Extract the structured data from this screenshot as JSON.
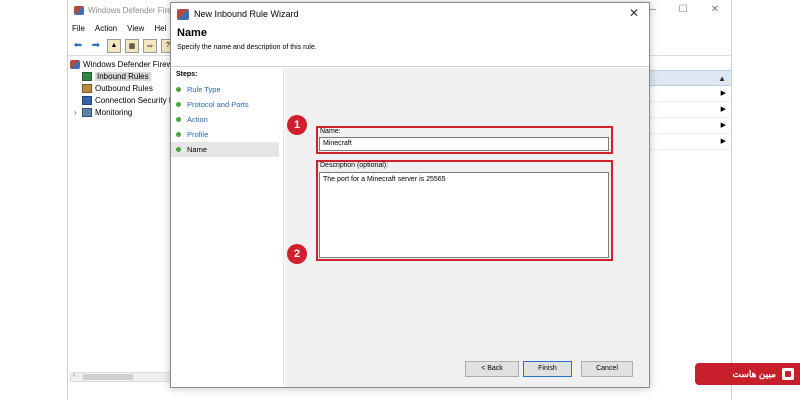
{
  "mmc": {
    "title": "Windows Defender Firev",
    "menu": [
      "File",
      "Action",
      "View",
      "Hel"
    ],
    "tree": [
      {
        "label": "Windows Defender Firew",
        "icon": "firewall-icon",
        "caret": ""
      },
      {
        "label": "Inbound Rules",
        "icon": "inbound-rules-icon",
        "caret": ""
      },
      {
        "label": "Outbound Rules",
        "icon": "outbound-rules-icon",
        "caret": ""
      },
      {
        "label": "Connection Security R",
        "icon": "connection-security-icon",
        "caret": ""
      },
      {
        "label": "Monitoring",
        "icon": "monitoring-icon",
        "caret": "›"
      }
    ],
    "right_header": "▲",
    "right_arrows": [
      "▶",
      "▶",
      "▶",
      "▶"
    ]
  },
  "wizard": {
    "title": "New Inbound Rule Wizard",
    "heading": "Name",
    "subtitle": "Specify the name and description of this rule.",
    "steps_label": "Steps:",
    "steps": [
      "Rule Type",
      "Protocol and Ports",
      "Action",
      "Profile",
      "Name"
    ],
    "current_step": "Name",
    "name_label": "Name:",
    "name_value": "Minecraft",
    "desc_label": "Description (optional):",
    "desc_value": "The port for a Minecraft server is 25565",
    "back_label": "< Back",
    "finish_label": "Finish",
    "cancel_label": "Cancel",
    "close_glyph": "✕"
  },
  "annotations": {
    "badge1": "1",
    "badge2": "2",
    "color": "#d0202e"
  },
  "watermark": {
    "text": "مبین هاست"
  }
}
